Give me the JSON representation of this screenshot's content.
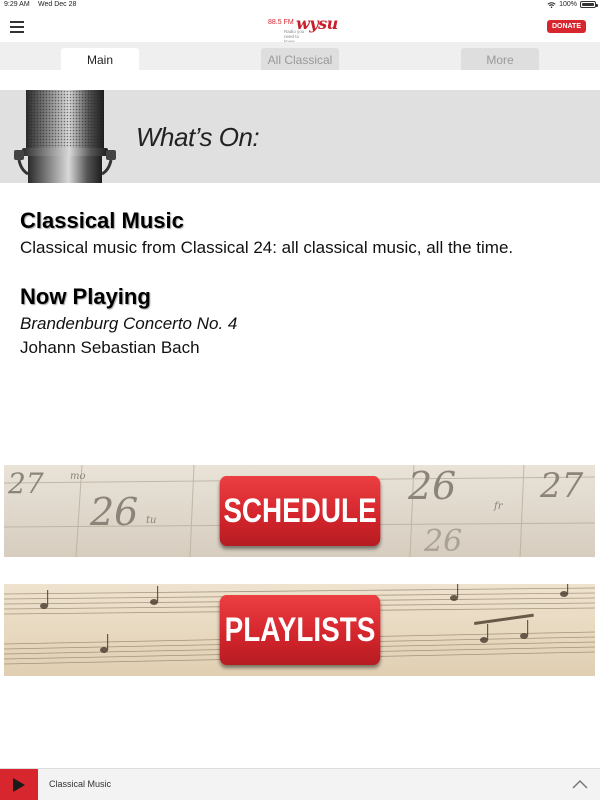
{
  "status_bar": {
    "time": "9:29 AM",
    "date": "Wed Dec 28",
    "battery": "100%"
  },
  "header": {
    "logo_freq": "88.5 FM",
    "logo_brand": "wysu",
    "logo_tagline": "Radio you need to know",
    "donate_label": "DONATE"
  },
  "tabs": [
    {
      "label": "Main",
      "active": true
    },
    {
      "label": "All Classical",
      "active": false
    },
    {
      "label": "More",
      "active": false
    }
  ],
  "banner": {
    "title": "What’s On:"
  },
  "program": {
    "heading": "Classical Music",
    "description": "Classical music from Classical 24: all classical music, all the time."
  },
  "now_playing": {
    "heading": "Now Playing",
    "title": "Brandenburg Concerto No. 4",
    "artist": "Johann Sebastian Bach"
  },
  "features": {
    "schedule_label": "SCHEDULE",
    "playlists_label": "PLAYLISTS",
    "calendar_numbers": [
      "27",
      "26",
      "26",
      "27",
      "26",
      "fr",
      "tu",
      "mo"
    ]
  },
  "player": {
    "label": "Classical Music"
  },
  "colors": {
    "accent": "#d7262e",
    "banner_bg": "#e0e0e0",
    "tabbar_bg": "#efefef"
  }
}
